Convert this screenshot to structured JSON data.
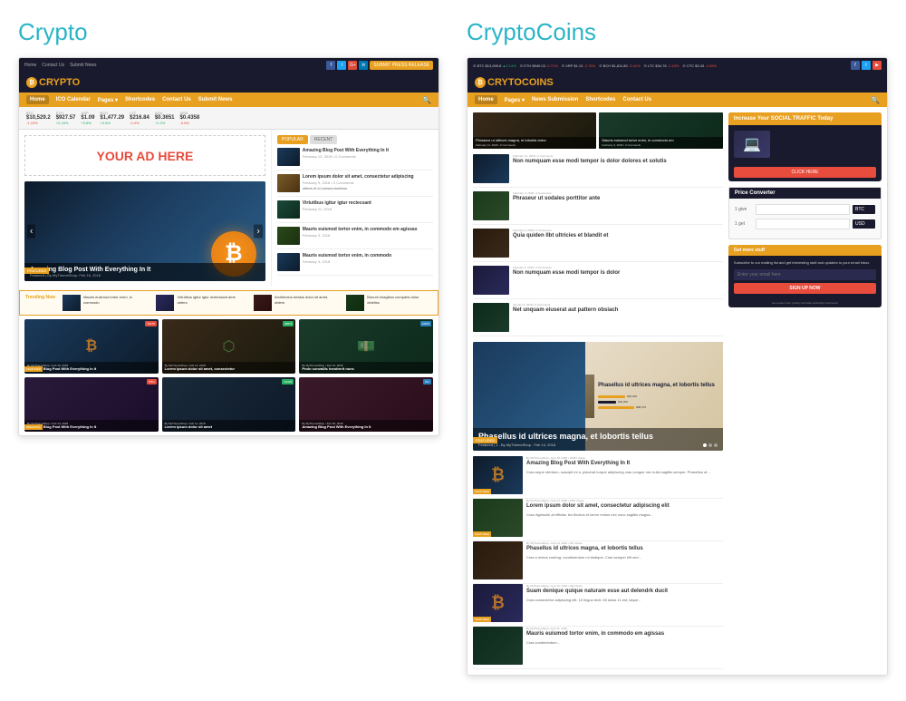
{
  "page": {
    "background": "#ffffff"
  },
  "left_section": {
    "title": "Crypto",
    "mockup": {
      "top_bar": {
        "links": [
          "Home",
          "Contact Us",
          "Submit News"
        ],
        "social": [
          "f",
          "G+",
          "in"
        ],
        "submit_btn": "SUBMIT PRESS RELEASE"
      },
      "header": {
        "logo_text": "CRYPTO",
        "logo_icon": "₿"
      },
      "nav": {
        "items": [
          "Home",
          "ICO Calendar",
          "Pages",
          "Shortcodes",
          "Contact Us",
          "Submit News"
        ]
      },
      "ticker": {
        "items": [
          {
            "name": "BTC",
            "price": "$10,529.2",
            "change": "-1.23%",
            "up": false
          },
          {
            "name": "ETH",
            "price": "$927.57",
            "change": "+2.15%",
            "up": true
          },
          {
            "name": "XRP",
            "price": "$1.09",
            "change": "+0.8%",
            "up": true
          },
          {
            "name": "BCH",
            "price": "$1,477.29",
            "change": "+3.5%",
            "up": true
          },
          {
            "name": "LTC",
            "price": "$216.84",
            "change": "-0.4%",
            "up": false
          },
          {
            "name": "ADA",
            "price": "$0.3651",
            "change": "+1.2%",
            "up": true
          },
          {
            "name": "XEM",
            "price": "$0.4358",
            "change": "-0.8%",
            "up": false
          }
        ]
      },
      "ad_banner": {
        "text": "YOUR AD HERE"
      },
      "featured_post": {
        "title": "Amazing Blog Post With Everything In It",
        "meta": "Featured | By MyThemeShop, Feb 16, 2018"
      },
      "tabs": [
        "POPULAR",
        "RECENT"
      ],
      "sidebar_posts": [
        {
          "title": "Amazing Blog Post With Everything In It",
          "meta": "February 13, 2018 • 0 Comments",
          "desc": ""
        },
        {
          "title": "Lorem ipsum dolor sit amet, consectetur adipiscing",
          "meta": "February 9, 2018 • 0 Comments",
          "desc": ""
        },
        {
          "title": "Virtutibus igitur igtur rectecsant ame obters et id consecutunlinss",
          "meta": "February 11, 2018",
          "desc": ""
        },
        {
          "title": "Mauris euismod tortor enim, in commodo em agissas",
          "meta": "February 3, 2018",
          "desc": ""
        },
        {
          "title": "Mauris euismod tortor enim, in commodo",
          "meta": "February 3, 2018",
          "desc": ""
        }
      ],
      "trending": {
        "label": "Trending Now",
        "items": [
          {
            "title": "Mauris euismod tortor enim, in commodo"
          },
          {
            "title": "Virtutibus igitur igtur reclecisant ame obters et id consecutunlinss"
          },
          {
            "title": "Architectus beatus dolor sit amet, obters et id"
          },
          {
            "title": "Bonum imagibus comparis dolor deletiss"
          }
        ]
      },
      "grid_cards": [
        {
          "badge": "26278",
          "meta": "By MyThemeShop • Feb 16, 2018",
          "title": "Amazing Blog Post With Everything In It",
          "badge_color": "red"
        },
        {
          "badge": "28873",
          "meta": "By MyThemeShop • Feb 14, 2018",
          "title": "Lorem ipsum dolor sit amet, consectetur adipiscing elit",
          "badge_color": "green"
        },
        {
          "badge": "26878",
          "meta": "By MyThemeShop • Feb 13, 2018",
          "title": "Proin convallis hendrerit nunc, id placerat quam porttitor sit amet",
          "badge_color": "blue"
        },
        {
          "badge": "BTG",
          "meta": "By MyThemeShop • Feb 13, 2018",
          "title": "Amazing Blog Post With Everything In It",
          "badge_color": "red"
        },
        {
          "badge": "N1225",
          "meta": "By MyThemeShop • Feb 11, 2018",
          "title": "Lorem ipsum dolor sit amet, consectetur adipiscing",
          "badge_color": "green"
        },
        {
          "badge": "547",
          "meta": "By MyThemeShop • Feb 18, 2018",
          "title": "Amazing Blog Post With Everything In It",
          "badge_color": "blue"
        }
      ]
    }
  },
  "right_section": {
    "title": "CryptoCoins",
    "mockup": {
      "top_bar": {
        "ticker_items": [
          "BTC $13,895.8 ▲0.14%",
          "ETH $940.03 -0.71%",
          "XRP $1.13 -2.76%",
          "BCH $1,811.80 -3.41%",
          "LTC $34.78 -2.43%",
          "CTC $3.43 -3.45%"
        ],
        "social": [
          "f",
          "tw",
          "yt"
        ]
      },
      "header": {
        "logo_text": "CRYTOCOINS",
        "logo_icon": "₿"
      },
      "nav": {
        "items": [
          "Home",
          "Pages",
          "News Submission",
          "Shortcodes",
          "Contact Us"
        ]
      },
      "featured_large": {
        "title": "Phasellus id ultrices magna, et lobortis tellus",
        "meta": "Featured | 1 - By MyThemeShop - Feb 14, 2018",
        "dots": 3
      },
      "top_posts": [
        {
          "title": "Phraseur ut ultrices magna, et lobortis tortor enim, in commodo egestas"
        },
        {
          "title": "Mauris euismod tortor enim, in commodo em comments egestas"
        }
      ],
      "small_posts_left": [
        {
          "title": "Non numquam esse modi tempor is dolor dolores et solutis",
          "date": "February 13, 2018 • 0 Comments"
        },
        {
          "title": "Phraseur ut sodales porttitor ante, consecat at lobortis tortor",
          "date": "February 3, 2018 • 2 Comments"
        },
        {
          "title": "Quia quiden llbt ultricies et blandit et",
          "date": "February 3, 2018 • 0 Comments"
        },
        {
          "title": "Non numquam esse modi tempor is dolor dolores et solutis",
          "date": "February 5, 2018 • 0 Comments"
        },
        {
          "title": "Net unquam eiuserat aut pattern obsiach",
          "date": "January 8, 2018 • 0 Comments"
        }
      ],
      "main_posts": [
        {
          "title": "Amazing Blog Post With Everything In It",
          "meta": "By MyThemeShop • Feb 18, 2018 • 20267 Views",
          "desc": "Cras arque nterdum, suscipit mi a, placerat torque adipiscing cras congue nec nulla sagittis semper. Phasellus at ...",
          "badge": "FEATURED"
        },
        {
          "title": "Lorem ipsum dolor sit amet, consectetur adipiscing elit",
          "meta": "By MyThemeShop • Feb 14, 2018 • 4491 Views",
          "desc": "Cras dignissim at efficitur leo finctius et lorem metus nec nunc sagittis magna. Phasellus lorem quis eget alls. IIn the torquetur sit amet di ...",
          "badge": "FEATURED"
        },
        {
          "title": "Phasellus id ultrices magna, et lobortis tellus",
          "meta": "By MyThemeShop • Feb 14, 2018 • 267 Views",
          "desc": "Cras a metus codring, condimentum mi tristique. Cras semper ellt sed. Maevris efficen odin nunc nulla magna eget suscipit id ...",
          "badge": ""
        },
        {
          "title": "Suam denique quique naturam esse aut delendrk ducit",
          "meta": "By MyThemeShop • Feb 14, 2018 • 200 Views",
          "desc": "Cras consectetur adipiscing elit. 10 lingus tech: Mi dolsa 11 est, idque. Idque, Vivant et turpis acumsan, recusant nisi ...",
          "badge": "FEATURED"
        },
        {
          "title": "Mauris euismod tortor enim, in commodo em agissas",
          "meta": "By MyThemeShop • Feb 11, 2018",
          "desc": "Cras condimentum...",
          "badge": ""
        }
      ],
      "sidebar": {
        "traffic_widget": {
          "header": "Increase Your SOCIAL TRAFFIC Today",
          "btn": "CLICK HERE"
        },
        "price_converter": {
          "title": "Price Converter",
          "from_label": "1 give",
          "to_label": "1 get",
          "from_currency": "BTC",
          "to_currency": "USD"
        },
        "email_widget": {
          "header": "Get more stuff",
          "text": "Subscribe to our mailing list and get interesting stuff and updates to your email inbox.",
          "placeholder": "Enter your email here",
          "btn": "SIGN UP NOW"
        }
      }
    }
  }
}
